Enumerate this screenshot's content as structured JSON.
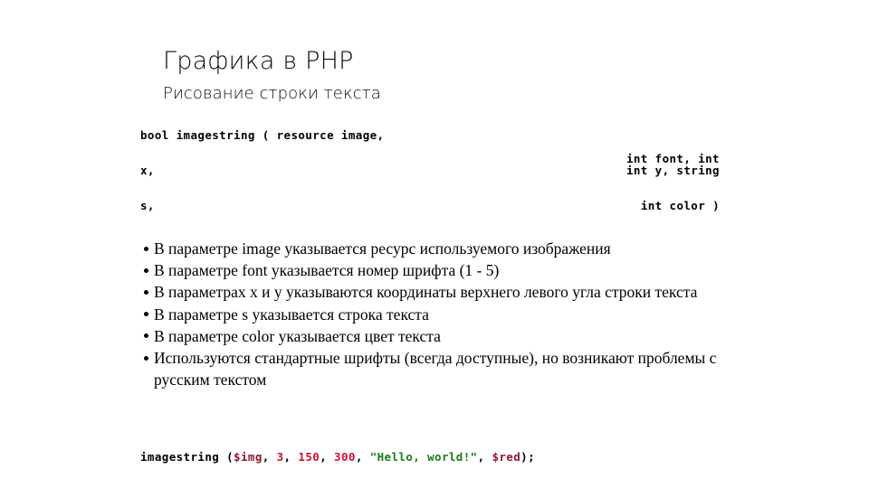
{
  "slide": {
    "title": "Графика в PHP",
    "subtitle": "Рисование строки текста"
  },
  "signature": {
    "rows": [
      {
        "left": "bool imagestring ( resource image,",
        "right": "int font, int"
      },
      {
        "left": "x,",
        "right": "int y, string"
      },
      {
        "left": "s,",
        "right": "int color )"
      }
    ]
  },
  "bullets": [
    "В параметре image указывается ресурс используемого изображения",
    "В параметре font указывается номер шрифта (1 - 5)",
    "В параметрах x и y указываются координаты верхнего левого угла строки текста",
    "В параметре s указывается строка текста",
    "В параметре color указывается цвет текста",
    "Используются стандартные шрифты (всегда доступные), но возникают проблемы с русским текстом"
  ],
  "code_example": {
    "full": "imagestring ($img, 3, 150, 300, \"Hello, world!\", $red);",
    "tokens": [
      {
        "text": "imagestring ",
        "kind": "fn"
      },
      {
        "text": "(",
        "kind": "punct"
      },
      {
        "text": "$img",
        "kind": "var"
      },
      {
        "text": ", ",
        "kind": "punct"
      },
      {
        "text": "3",
        "kind": "num"
      },
      {
        "text": ", ",
        "kind": "punct"
      },
      {
        "text": "150",
        "kind": "num"
      },
      {
        "text": ", ",
        "kind": "punct"
      },
      {
        "text": "300",
        "kind": "num"
      },
      {
        "text": ", ",
        "kind": "punct"
      },
      {
        "text": "\"Hello, world!\"",
        "kind": "str"
      },
      {
        "text": ", ",
        "kind": "punct"
      },
      {
        "text": "$red",
        "kind": "var"
      },
      {
        "text": ");",
        "kind": "punct"
      }
    ]
  },
  "colors": {
    "background": "#ffffff",
    "text": "#000000",
    "number": "#cc1133",
    "string": "#1a7a1a",
    "variable": "#8b1a33"
  }
}
